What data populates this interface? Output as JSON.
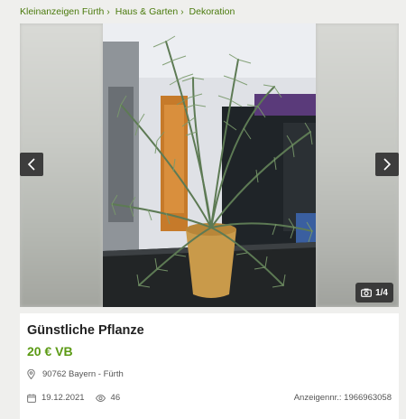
{
  "breadcrumb": {
    "items": [
      "Kleinanzeigen Fürth",
      "Haus & Garten",
      "Dekoration"
    ]
  },
  "gallery": {
    "counter": "1/4"
  },
  "listing": {
    "title": "Günstliche Pflanze",
    "price": "20 € VB",
    "location": "90762 Bayern - Fürth",
    "date": "19.12.2021",
    "views": "46",
    "ad_id": "Anzeigennr.: 1966963058"
  },
  "colors": {
    "link": "#4a7a0c",
    "price": "#5b9a14"
  }
}
